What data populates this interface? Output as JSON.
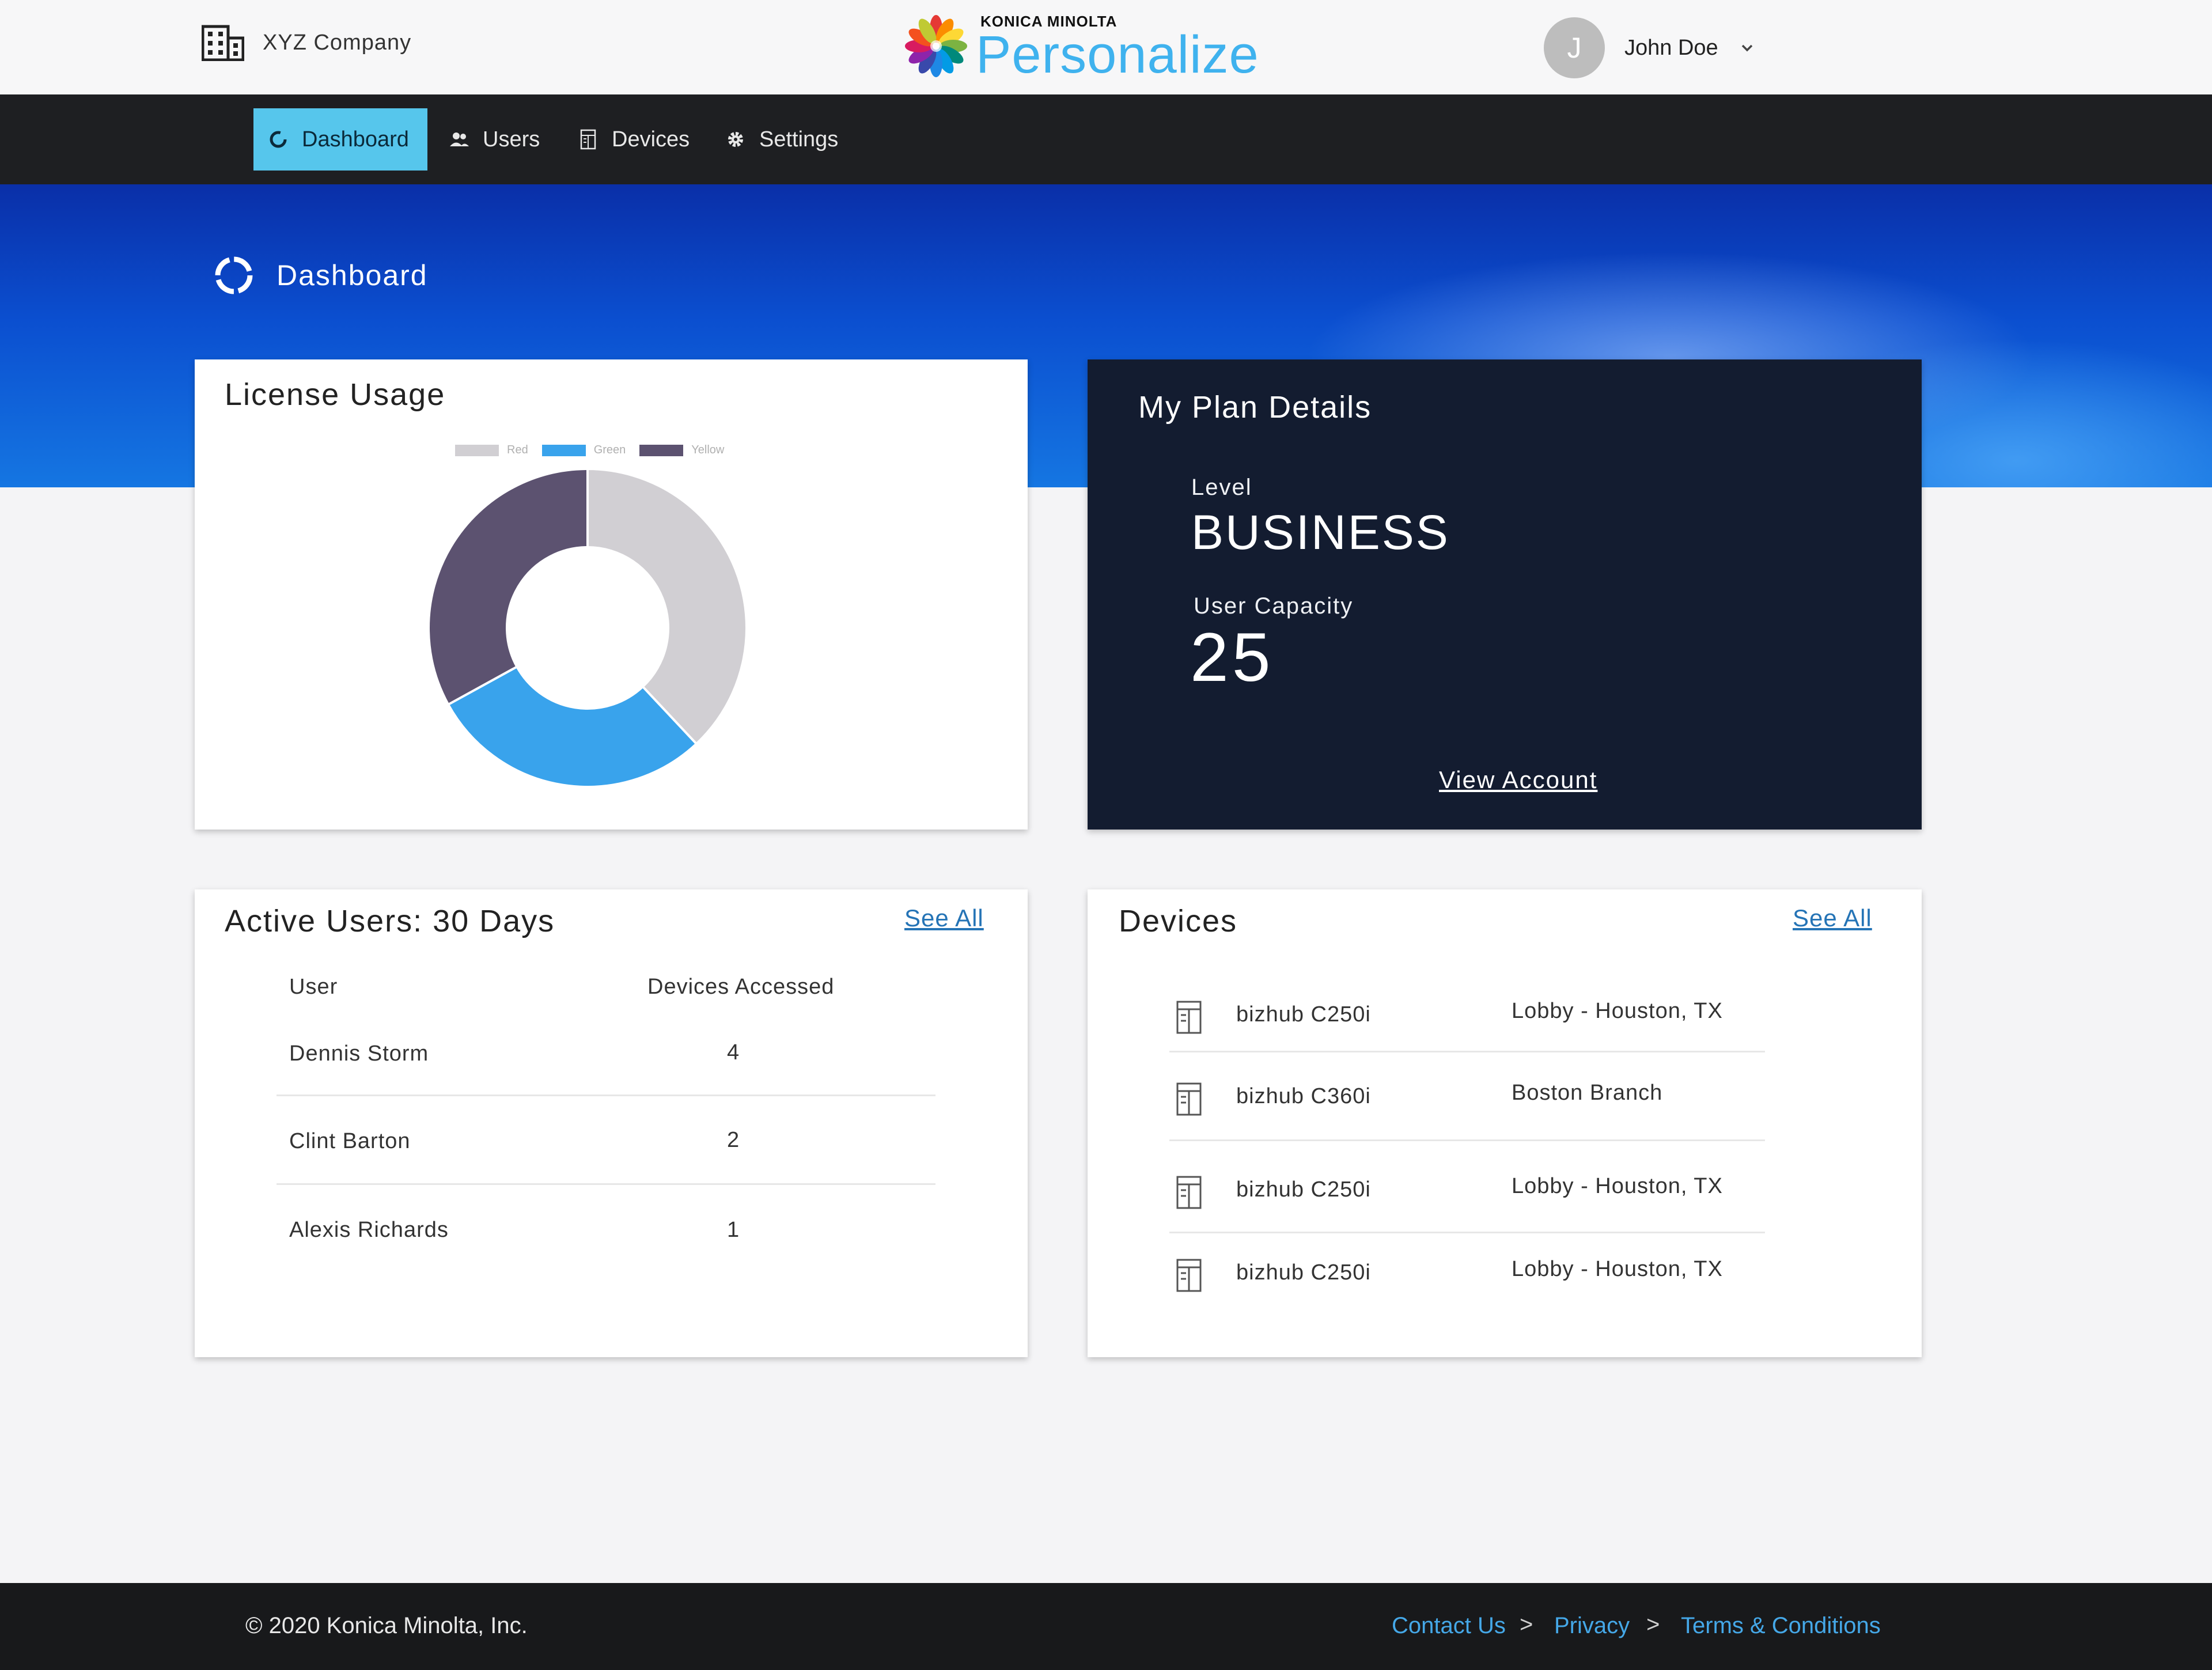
{
  "header": {
    "company_name": "XYZ Company",
    "brand_small": "KONICA MINOLTA",
    "brand_name": "Personalize",
    "user_initial": "J",
    "user_name": "John Doe"
  },
  "nav": {
    "items": [
      {
        "label": "Dashboard",
        "icon": "dashboard-ring-icon",
        "active": true
      },
      {
        "label": "Users",
        "icon": "users-icon",
        "active": false
      },
      {
        "label": "Devices",
        "icon": "device-icon",
        "active": false
      },
      {
        "label": "Settings",
        "icon": "gear-icon",
        "active": false
      }
    ]
  },
  "page": {
    "title": "Dashboard"
  },
  "license_usage": {
    "title": "License Usage",
    "legend": [
      {
        "label": "Red",
        "color": "#d1cfd3"
      },
      {
        "label": "Green",
        "color": "#39a3ec"
      },
      {
        "label": "Yellow",
        "color": "#5c5270"
      }
    ],
    "chart_data": {
      "type": "pie",
      "donut": true,
      "labels": [
        "Red",
        "Green",
        "Yellow"
      ],
      "values": [
        38,
        29,
        33
      ],
      "colors": [
        "#d1cfd3",
        "#39a3ec",
        "#5c5270"
      ]
    }
  },
  "plan": {
    "title": "My Plan Details",
    "level_label": "Level",
    "level_value": "BUSINESS",
    "capacity_label": "User Capacity",
    "capacity_value": "25",
    "view_account": "View Account"
  },
  "active_users": {
    "title": "Active Users: 30 Days",
    "see_all": "See All",
    "columns": [
      "User",
      "Devices Accessed"
    ],
    "rows": [
      {
        "user": "Dennis Storm",
        "devices": "4"
      },
      {
        "user": "Clint Barton",
        "devices": "2"
      },
      {
        "user": "Alexis Richards",
        "devices": "1"
      }
    ]
  },
  "devices": {
    "title": "Devices",
    "see_all": "See All",
    "rows": [
      {
        "model": "bizhub C250i",
        "location": "Lobby - Houston, TX"
      },
      {
        "model": "bizhub C360i",
        "location": "Boston Branch"
      },
      {
        "model": "bizhub C250i",
        "location": "Lobby - Houston, TX"
      },
      {
        "model": "bizhub C250i",
        "location": "Lobby - Houston, TX"
      }
    ]
  },
  "footer": {
    "copyright": "© 2020 Konica Minolta, Inc.",
    "links": [
      "Contact Us",
      "Privacy",
      "Terms & Conditions"
    ],
    "separator": ">"
  }
}
